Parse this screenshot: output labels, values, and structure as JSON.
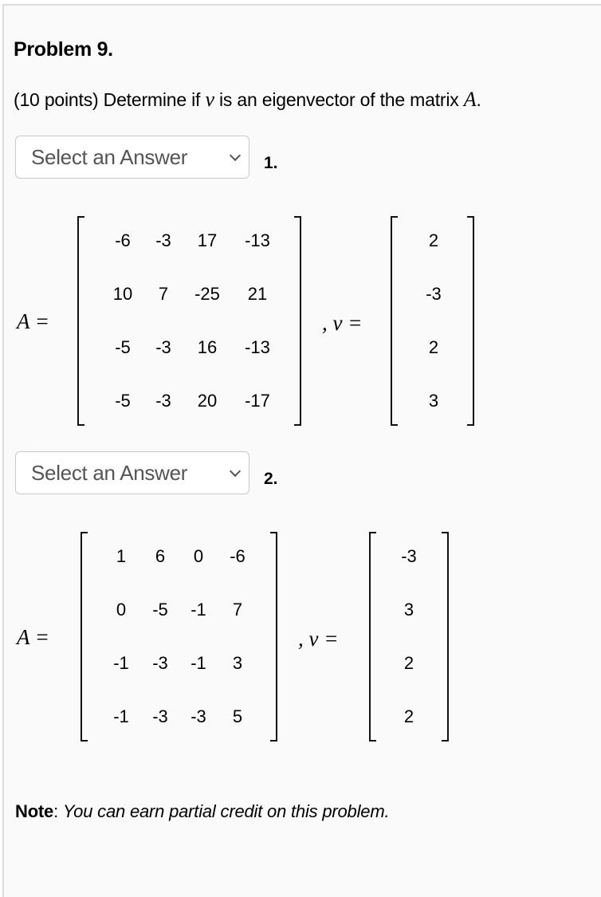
{
  "problem": {
    "title": "Problem 9.",
    "prompt_prefix": "(10 points) Determine if ",
    "prompt_var_v": "v",
    "prompt_middle": " is an eigenvector of the matrix ",
    "prompt_var_A": "A",
    "prompt_suffix": "."
  },
  "parts": [
    {
      "select_value": "Select an Answer",
      "label": "1.",
      "matrix_label": "A =",
      "vector_label": ", v =",
      "matrix": [
        [
          "-6",
          "-3",
          "17",
          "-13"
        ],
        [
          "10",
          "7",
          "-25",
          "21"
        ],
        [
          "-5",
          "-3",
          "16",
          "-13"
        ],
        [
          "-5",
          "-3",
          "20",
          "-17"
        ]
      ],
      "vector": [
        "2",
        "-3",
        "2",
        "3"
      ]
    },
    {
      "select_value": "Select an Answer",
      "label": "2.",
      "matrix_label": "A =",
      "vector_label": ", v =",
      "matrix": [
        [
          "1",
          "6",
          "0",
          "-6"
        ],
        [
          "0",
          "-5",
          "-1",
          "7"
        ],
        [
          "-1",
          "-3",
          "-1",
          "3"
        ],
        [
          "-1",
          "-3",
          "-3",
          "5"
        ]
      ],
      "vector": [
        "-3",
        "3",
        "2",
        "2"
      ]
    }
  ],
  "note": {
    "label": "Note",
    "colon": ": ",
    "text": "You can earn partial credit on this problem."
  }
}
